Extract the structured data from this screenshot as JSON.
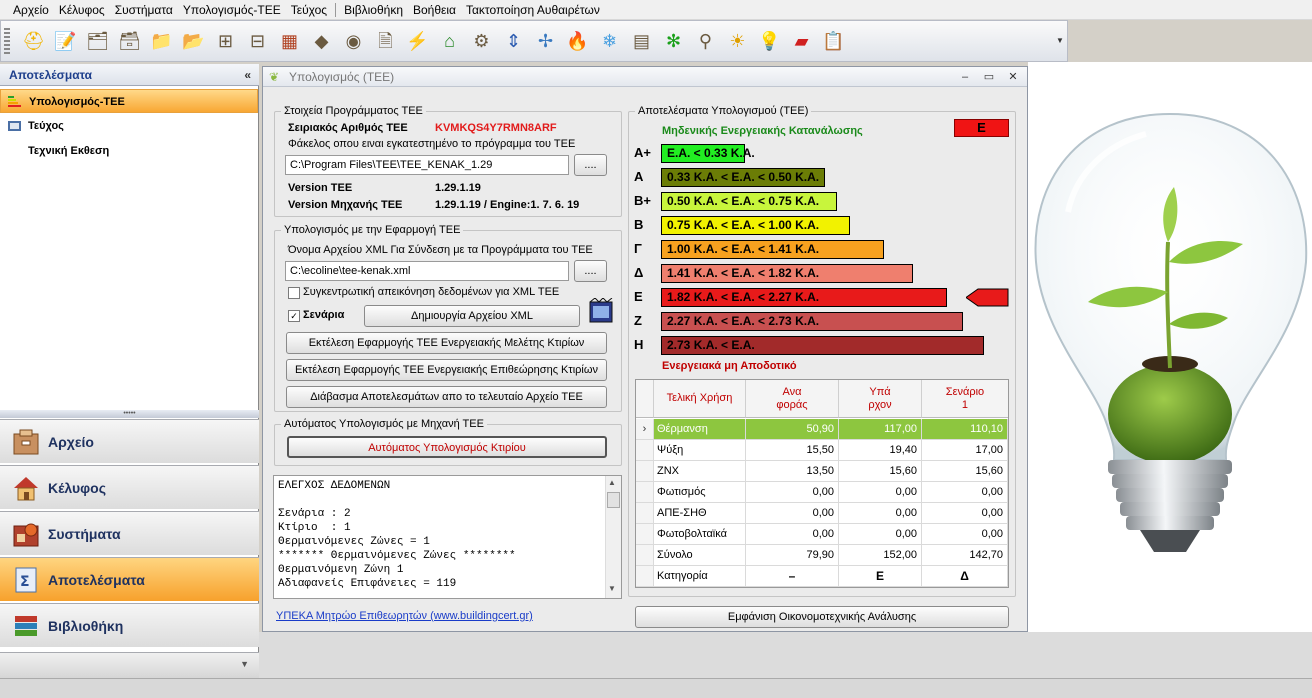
{
  "menu": [
    "Αρχείο",
    "Κέλυφος",
    "Συστήματα",
    "Υπολογισμός-ΤΕΕ",
    "Τεύχος",
    "Βιβλιοθήκη",
    "Βοήθεια",
    "Τακτοποίηση Αυθαιρέτων"
  ],
  "toolbar_icons": [
    "helmet-icon",
    "notepad-icon",
    "papers-icon",
    "papers2-icon",
    "folder-wall-icon",
    "folder-brick-icon",
    "window-icon",
    "window2-icon",
    "brick-icon",
    "stone-icon",
    "circle-icon",
    "document-icon",
    "pylon-icon",
    "house-heat-icon",
    "pipe-icon",
    "door-arrow-icon",
    "wind-turbine-icon",
    "fire-icon",
    "snowflake-icon",
    "radiator-icon",
    "green-snowflake-icon",
    "tap-icon",
    "solar-icon",
    "bulb-icon",
    "energy-chart-icon",
    "clipboard-icon"
  ],
  "nav": {
    "title": "Αποτελέσματα",
    "collapse": "«",
    "items": [
      {
        "label": "Υπολογισμός-ΤΕΕ",
        "icon": "energy-chart-icon"
      },
      {
        "label": "Τεύχος",
        "icon": "book-icon"
      },
      {
        "label": "Τεχνική Εκθεση",
        "icon": ""
      }
    ],
    "buttons": [
      {
        "label": "Αρχείο",
        "icon": "archive-icon"
      },
      {
        "label": "Κέλυφος",
        "icon": "house-icon"
      },
      {
        "label": "Συστήματα",
        "icon": "systems-icon"
      },
      {
        "label": "Αποτελέσματα",
        "icon": "results-icon"
      },
      {
        "label": "Βιβλιοθήκη",
        "icon": "library-icon"
      }
    ]
  },
  "dialog": {
    "title": "Υπολογισμός (ΤΕΕ)",
    "program": {
      "legend": "Στοιχεία Προγράμματος ΤΕΕ",
      "serial_label": "Σειριακός Αριθμός ΤΕΕ",
      "serial_value": "KVMKQS4Y7RMN8ARF",
      "folder_label": "Φάκελος οπου ειναι εγκατεστημένο το πρόγραμμα του ΤΕΕ",
      "folder_value": "C:\\Program Files\\TEE\\TEE_KENAK_1.29",
      "browse": "....",
      "version_label": "Version ΤΕΕ",
      "version_value": "1.29.1.19",
      "engine_label": "Version Μηχανής ΤΕΕ",
      "engine_value": "1.29.1.19 / Engine:1. 7. 6. 19"
    },
    "app": {
      "legend": "Υπολογισμός με την Εφαρμογή ΤΕΕ",
      "xml_label": "Όνομα Αρχείου XML Για Σύνδεση με τα Προγράμματα του ΤΕΕ",
      "xml_value": "C:\\ecoline\\tee-kenak.xml",
      "browse": "....",
      "summary_check": "Συγκεντρωτική απεικόνηση δεδομένων για XML ΤΕΕ",
      "scenario_check": "Σενάρια",
      "create_xml": "Δημιουργία Αρχείου XML",
      "run_study": "Εκτέλεση Εφαρμογής ΤΕΕ Ενεργειακής Μελέτης Κτιρίων",
      "run_inspection": "Εκτέλεση  Εφαρμογής ΤΕΕ Ενεργειακής Επιθεώρησης Κτιρίων",
      "read_results": "Διάβασμα Αποτελεσμάτων απο το τελευταίο Αρχείο ΤΕΕ"
    },
    "auto": {
      "legend": "Αυτόματος Υπολογισμός με Μηχανή ΤΕΕ",
      "button": "Αυτόματος Υπολογισμός Κτιρίου"
    },
    "memo": "ΕΛΕΓΧΟΣ ΔΕΔΟΜΕΝΩΝ\n\nΣενάρια : 2\nΚτίριο  : 1\nΘερμαινόμενες Ζώνες = 1\n******* Θερμαινόμενες Ζώνες ********\nΘερμαινόμενη Ζώνη 1\nΑδιαφανείς Επιφάνειες = 119",
    "link": "ΥΠΕΚΑ Μητρώο Επιθεωρητών (www.buildingcert.gr)",
    "results": {
      "legend": "Αποτελέσματα Υπολογισμού (ΤΕΕ)",
      "top_label": "Μηδενικής Ενεργειακής Κατανάλωσης",
      "badge": "Ε",
      "bottom_label": "Ενεργειακά μη Αποδοτικό",
      "classes": [
        {
          "cls": "Α+",
          "text": "Ε.Α. < 0.33 Κ.Α.",
          "color": "#22ee22",
          "fill": 0.2
        },
        {
          "cls": "Α",
          "text": "0.33 Κ.Α. <  Ε.Α.  < 0.50 Κ.Α.",
          "color": "#6b7d06",
          "fill": 0.39
        },
        {
          "cls": "Β+",
          "text": "0.50 Κ.Α. <  Ε.Α.  < 0.75 Κ.Α.",
          "color": "#c8f53c",
          "fill": 0.42
        },
        {
          "cls": "Β",
          "text": "0.75 Κ.Α. <  Ε.Α.  < 1.00 Κ.Α.",
          "color": "#f2f200",
          "fill": 0.45
        },
        {
          "cls": "Γ",
          "text": "1.00 Κ.Α. <  Ε.Α.  < 1.41 Κ.Α.",
          "color": "#f7a11f",
          "fill": 0.53
        },
        {
          "cls": "Δ",
          "text": "1.41 Κ.Α. <  Ε.Α.  < 1.82 Κ.Α.",
          "color": "#ef7f6e",
          "fill": 0.6
        },
        {
          "cls": "Ε",
          "text": "1.82 Κ.Α. <  Ε.Α.  < 2.27 Κ.Α.",
          "color": "#e81a1a",
          "fill": 0.68
        },
        {
          "cls": "Ζ",
          "text": "2.27 Κ.Α. <  Ε.Α.  < 2.73 Κ.Α.",
          "color": "#c85050",
          "fill": 0.72
        },
        {
          "cls": "Η",
          "text": "2.73 Κ.Α. <  Ε.Α.",
          "color": "#a22a2a",
          "fill": 0.77
        }
      ],
      "current_class": "Ε",
      "table": {
        "headers": [
          "Τελική Χρήση",
          "Ανα\nφοράς",
          "Υπά\nρχον",
          "Σενάριο\n1"
        ],
        "rows": [
          [
            "Θέρμανση",
            "50,90",
            "117,00",
            "110,10"
          ],
          [
            "Ψύξη",
            "15,50",
            "19,40",
            "17,00"
          ],
          [
            "ΖΝΧ",
            "13,50",
            "15,60",
            "15,60"
          ],
          [
            "Φωτισμός",
            "0,00",
            "0,00",
            "0,00"
          ],
          [
            "ΑΠΕ-ΣΗΘ",
            "0,00",
            "0,00",
            "0,00"
          ],
          [
            "Φωτοβολταϊκά",
            "0,00",
            "0,00",
            "0,00"
          ],
          [
            "Σύνολο",
            "79,90",
            "152,00",
            "142,70"
          ],
          [
            "Κατηγορία",
            "–",
            "Ε",
            "Δ"
          ]
        ]
      },
      "economic_button": "Εμφάνιση Οικονομοτεχνικής Ανάλυσης"
    }
  }
}
